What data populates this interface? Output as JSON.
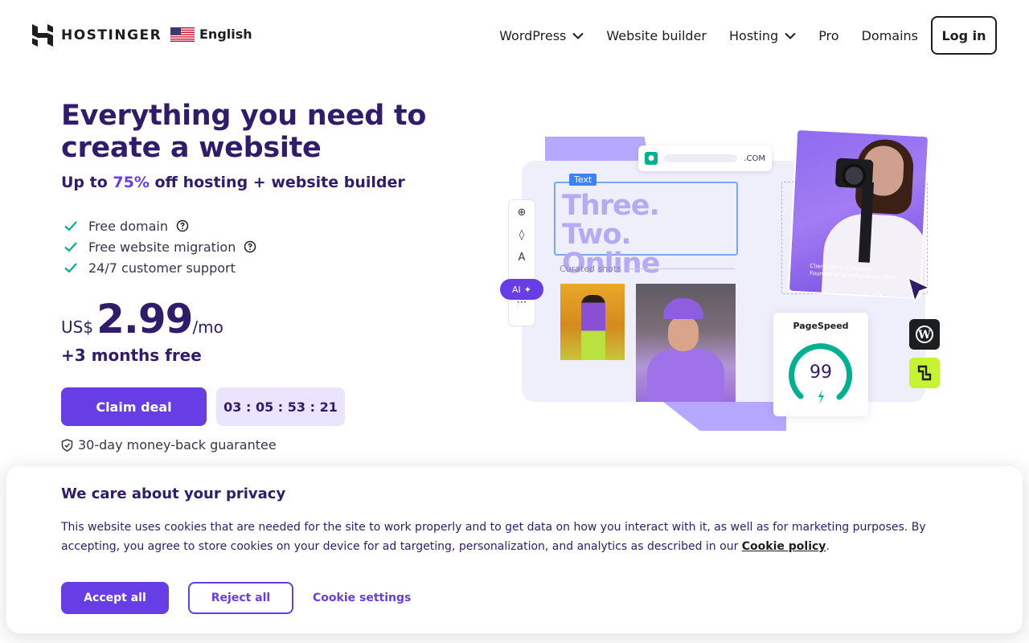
{
  "header": {
    "brand": "HOSTINGER",
    "language": "English",
    "nav": [
      {
        "label": "WordPress",
        "dropdown": true
      },
      {
        "label": "Website builder",
        "dropdown": false
      },
      {
        "label": "Hosting",
        "dropdown": true
      },
      {
        "label": "Pro",
        "dropdown": false
      },
      {
        "label": "Domains",
        "dropdown": false
      }
    ],
    "login_label": "Log in"
  },
  "hero": {
    "title": "Everything you need to create a website",
    "subtitle_prefix": "Up to ",
    "subtitle_accent": "75%",
    "subtitle_suffix": " off hosting + website builder",
    "features": [
      {
        "label": "Free domain",
        "help": true
      },
      {
        "label": "Free website migration",
        "help": true
      },
      {
        "label": "24/7 customer support",
        "help": false
      }
    ],
    "price_currency": "US$",
    "price_amount": "2.99",
    "price_period": "/mo",
    "bonus": "+3 months free",
    "cta_label": "Claim deal",
    "timer": "03 : 05 : 53 : 21",
    "guarantee": "30-day money-back guarantee"
  },
  "illustration": {
    "url_tld": ".COM",
    "text_tag": "Text",
    "headline": "Three. Two. Online",
    "curated_label": "Curated shots",
    "ai_label": "AI",
    "photo_caption": "Client: Anna Franquez\nFounder of annafranquez.com",
    "pagespeed_title": "PageSpeed",
    "pagespeed_score": "99"
  },
  "cookie": {
    "title": "We care about your privacy",
    "text": "This website uses cookies that are needed for the site to work properly and to get data on how you interact with it, as well as for marketing purposes. By accepting, you agree to store cookies on your device for ad targeting, personalization, and analytics as described in our ",
    "policy_link": "Cookie policy",
    "text_end": ".",
    "accept_label": "Accept all",
    "reject_label": "Reject all",
    "settings_label": "Cookie settings"
  },
  "colors": {
    "brand_purple": "#673de6",
    "dark_purple": "#2f1c6a",
    "timer_bg": "#ebe4ff",
    "success_green": "#00b090"
  }
}
